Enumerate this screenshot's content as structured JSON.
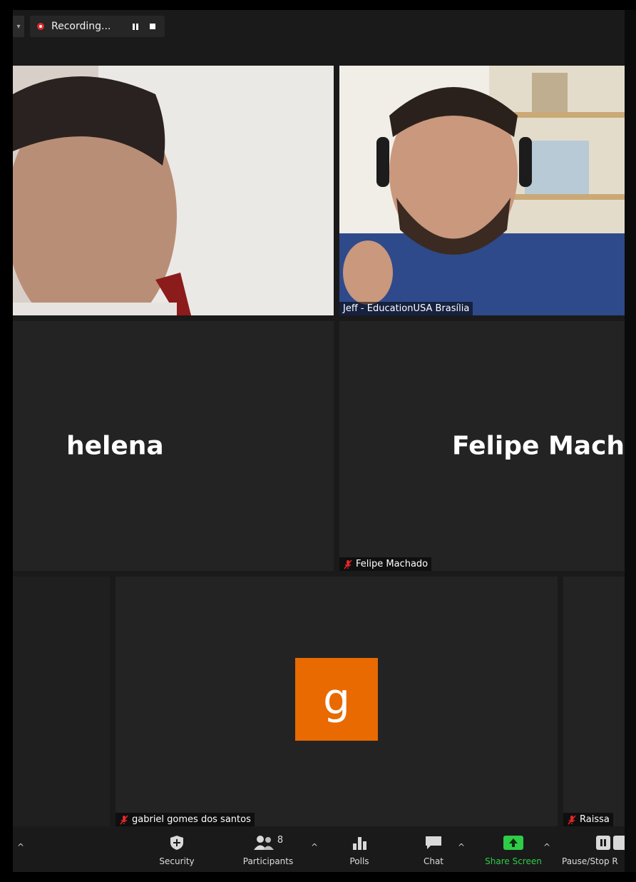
{
  "recording": {
    "label": "Recording..."
  },
  "tiles": {
    "helena": {
      "name": "helena"
    },
    "jeff": {
      "name": "Jeff - EducationUSA Brasília"
    },
    "felipe": {
      "big_name": "Felipe Macha",
      "name": "Felipe Machado"
    },
    "gabriel": {
      "initial": "g",
      "name": "gabriel gomes dos santos",
      "avatar_color": "#e86a00"
    },
    "raissa": {
      "name": "Raissa"
    }
  },
  "toolbar": {
    "security": "Security",
    "participants": "Participants",
    "participants_count": "8",
    "polls": "Polls",
    "chat": "Chat",
    "share_screen": "Share Screen",
    "pause_stop": "Pause/Stop R"
  },
  "colors": {
    "share_green": "#2ecc47",
    "muted_red": "#e02828"
  }
}
